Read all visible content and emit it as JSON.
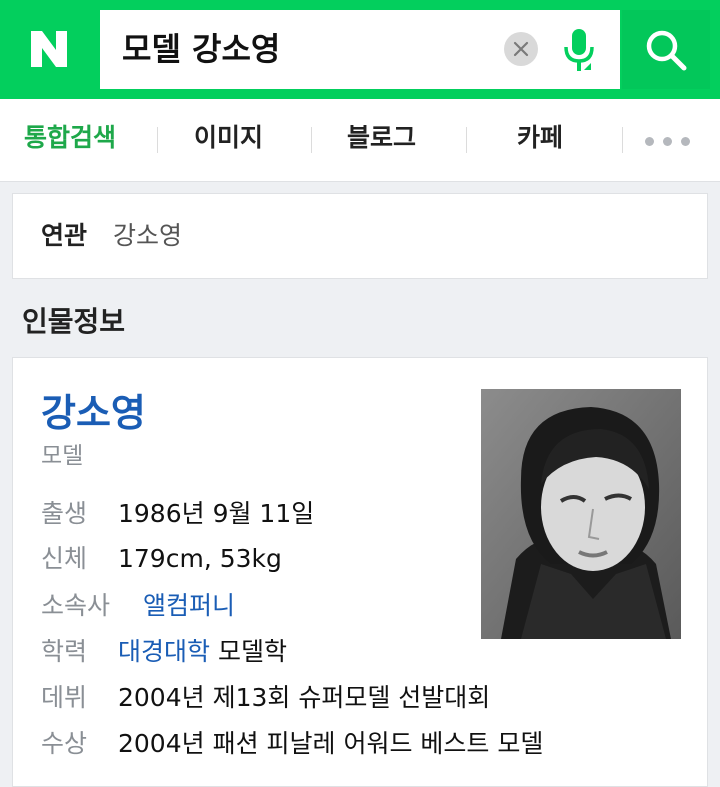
{
  "search": {
    "query": "모델 강소영"
  },
  "tabs": [
    {
      "label": "통합검색"
    },
    {
      "label": "이미지"
    },
    {
      "label": "블로그"
    },
    {
      "label": "카페"
    }
  ],
  "related": {
    "label": "연관",
    "value": "강소영"
  },
  "section": {
    "title": "인물정보"
  },
  "person": {
    "name": "강소영",
    "role": "모델",
    "rows": [
      {
        "label": "출생",
        "value": "1986년 9월 11일"
      },
      {
        "label": "신체",
        "value": "179cm, 53kg"
      },
      {
        "label": "소속사",
        "link": "앨컴퍼니"
      },
      {
        "label": "학력",
        "link": "대경대학",
        "value": " 모델학"
      },
      {
        "label": "데뷔",
        "value": "2004년 제13회 슈퍼모델 선발대회"
      },
      {
        "label": "수상",
        "value": "2004년 패션 피날레 어워드 베스트 모델"
      }
    ]
  },
  "colors": {
    "brand": "#03cf5d",
    "link": "#1a5db5",
    "active_tab": "#1ea84a"
  },
  "icons": [
    "naver-logo-icon",
    "clear-icon",
    "mic-icon",
    "search-icon",
    "more-icon"
  ]
}
